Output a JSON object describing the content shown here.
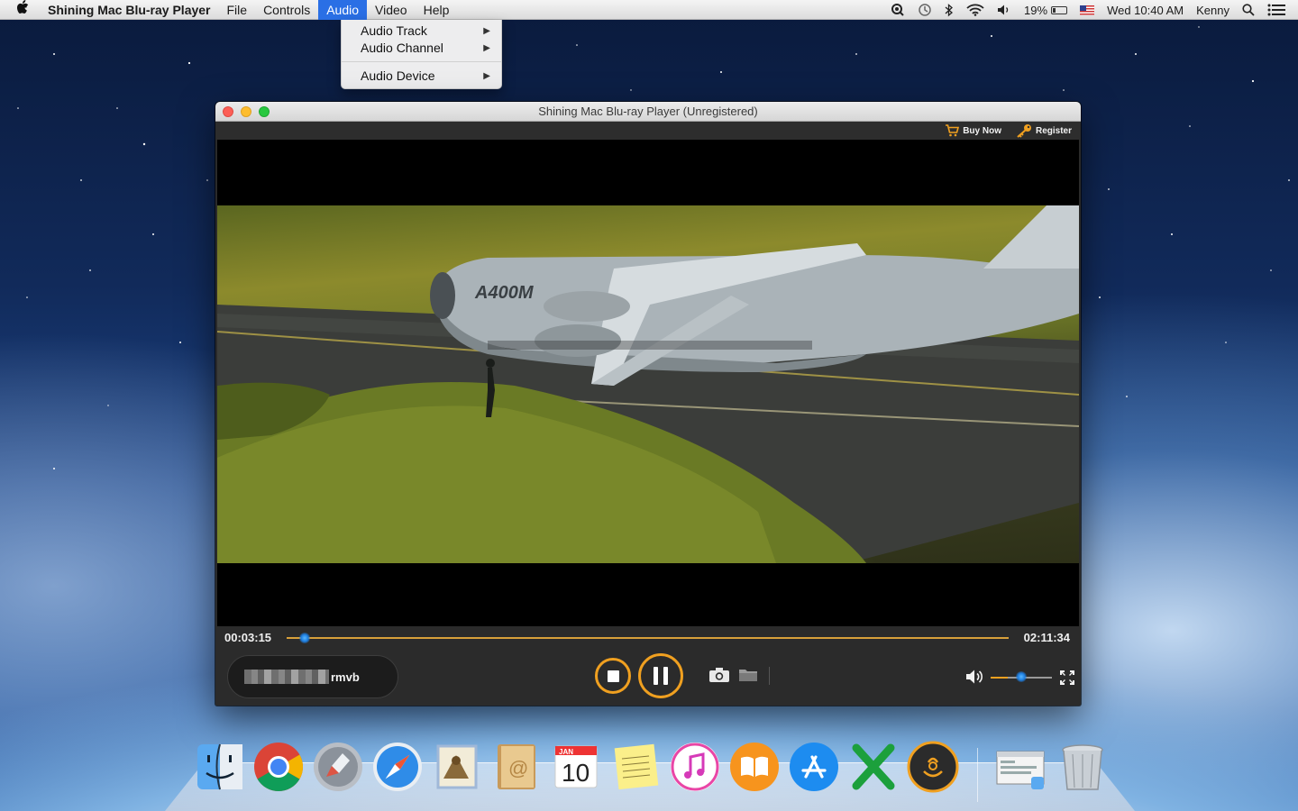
{
  "menubar": {
    "app_name": "Shining Mac Blu-ray Player",
    "items": [
      "File",
      "Controls",
      "Audio",
      "Video",
      "Help"
    ],
    "active_item": "Audio",
    "battery": "19%",
    "clock": "Wed 10:40 AM",
    "user": "Kenny"
  },
  "audio_menu": {
    "items": [
      {
        "label": "Audio Track",
        "has_submenu": true
      },
      {
        "label": "Audio Channel",
        "has_submenu": true
      },
      {
        "label": "Audio Device",
        "has_submenu": true
      }
    ]
  },
  "player": {
    "title": "Shining Mac Blu-ray Player (Unregistered)",
    "buy_now": "Buy Now",
    "register": "Register",
    "video_overlay_text": "A400M",
    "current_time": "00:03:15",
    "total_time": "02:11:34",
    "playback_progress": 0.025,
    "volume_level": 0.5,
    "file_name_suffix": "rmvb",
    "state": "playing"
  },
  "dock": {
    "apps": [
      "finder-icon",
      "chrome-icon",
      "launchpad-icon",
      "safari-icon",
      "mail-icon",
      "contacts-icon",
      "calendar-icon",
      "notes-icon",
      "itunes-icon",
      "ibooks-icon",
      "app-store-icon",
      "excel-icon",
      "player-app-icon",
      "finder-window-icon",
      "trash-icon"
    ],
    "calendar_month": "JAN",
    "calendar_day": "10"
  },
  "colors": {
    "accent_orange": "#f0a020",
    "menu_highlight": "#2a6fe5",
    "knob_blue": "#1e7ee0"
  }
}
